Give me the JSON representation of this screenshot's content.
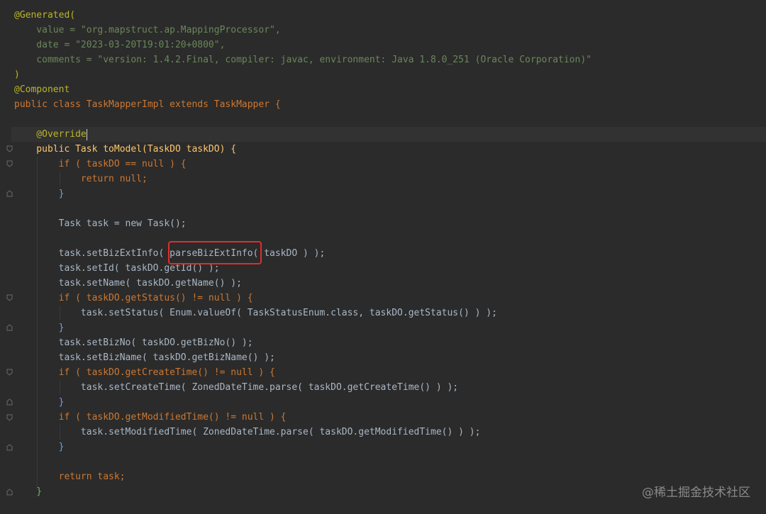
{
  "editor": {
    "lines": [
      "@Generated(",
      "    value = \"org.mapstruct.ap.MappingProcessor\",",
      "    date = \"2023-03-20T19:01:20+0800\",",
      "    comments = \"version: 1.4.2.Final, compiler: javac, environment: Java 1.8.0_251 (Oracle Corporation)\"",
      ")",
      "@Component",
      "public class TaskMapperImpl extends TaskMapper {",
      "",
      "    @Override",
      "    public Task toModel(TaskDO taskDO) {",
      "        if ( taskDO == null ) {",
      "            return null;",
      "        }",
      "",
      "        Task task = new Task();",
      "",
      "        task.setBizExtInfo( parseBizExtInfo( taskDO ) );",
      "        task.setId( taskDO.getId() );",
      "        task.setName( taskDO.getName() );",
      "        if ( taskDO.getStatus() != null ) {",
      "            task.setStatus( Enum.valueOf( TaskStatusEnum.class, taskDO.getStatus() ) );",
      "        }",
      "        task.setBizNo( taskDO.getBizNo() );",
      "        task.setBizName( taskDO.getBizName() );",
      "        if ( taskDO.getCreateTime() != null ) {",
      "            task.setCreateTime( ZonedDateTime.parse( taskDO.getCreateTime() ) );",
      "        }",
      "        if ( taskDO.getModifiedTime() != null ) {",
      "            task.setModifiedTime( ZonedDateTime.parse( taskDO.getModifiedTime() ) );",
      "        }",
      "",
      "        return task;",
      "    }"
    ],
    "highlighted_token": "parseBizExtInfo",
    "current_line": 9
  },
  "watermark": "@稀土掘金技术社区",
  "colors": {
    "background": "#2b2b2b",
    "keyword": "#cc7832",
    "string": "#6a8759",
    "annotation": "#bbb529",
    "method": "#ffc66d",
    "text": "#a9b7c6",
    "highlight_box": "#e02d2d"
  },
  "icons": [
    "lightbulb-icon",
    "fold-marker-icon"
  ]
}
